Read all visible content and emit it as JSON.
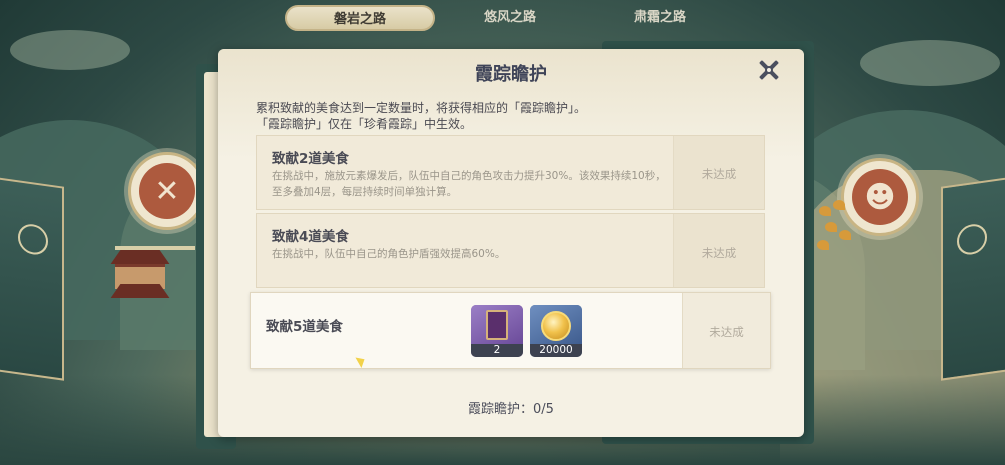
{
  "tabs": [
    "磐岩之路",
    "悠风之路",
    "肃霜之路"
  ],
  "active_tab": "磐岩之路",
  "panel": {
    "title": "霞踪瞻护",
    "description": [
      "累积致献的美食达到一定数量时，将获得相应的「霞踪瞻护」。",
      "「霞踪瞻护」仅在「珍肴霞踪」中生效。"
    ],
    "items": [
      {
        "name": "致献2道美食",
        "effect": "在挑战中，施放元素爆发后，队伍中自己的角色攻击力提升30%。该效果持续10秒，至多叠加4层，每层持续时间单独计算。",
        "status": "未达成"
      },
      {
        "name": "致献4道美食",
        "effect": "在挑战中，队伍中自己的角色护盾强效提高60%。",
        "status": "未达成"
      },
      {
        "name": "致献5道美食",
        "rewards": [
          {
            "icon": "purple-book-icon",
            "count": "2"
          },
          {
            "icon": "mora-coin-icon",
            "count": "20000"
          }
        ],
        "status": "未达成"
      }
    ],
    "progress": "霞踪瞻护：0/5"
  },
  "colors": {
    "panel_bg": "#f5f1e4",
    "title_text": "#3f4458",
    "status_text": "#b1aa9d",
    "active_tab": "#eae2c9"
  }
}
